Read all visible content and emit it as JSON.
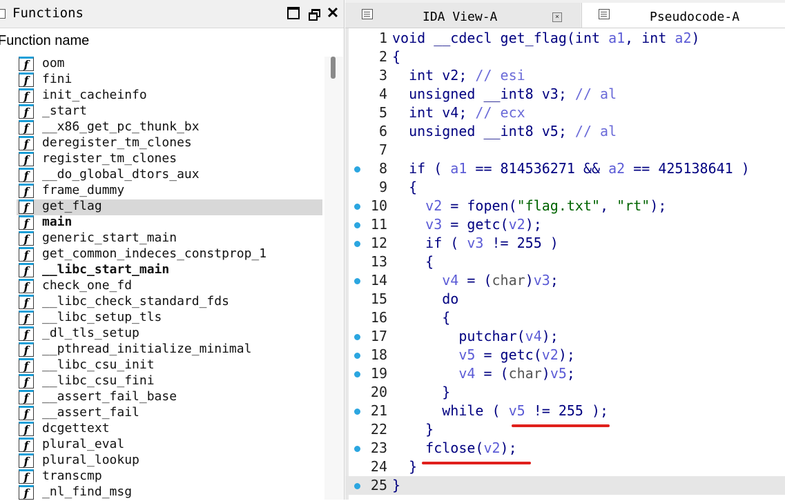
{
  "functions_panel": {
    "title": "Functions",
    "column_header": "Function name",
    "icon_glyph": "f",
    "items": [
      {
        "name": "oom",
        "bold": false,
        "selected": false
      },
      {
        "name": "fini",
        "bold": false,
        "selected": false
      },
      {
        "name": "init_cacheinfo",
        "bold": false,
        "selected": false
      },
      {
        "name": "_start",
        "bold": false,
        "selected": false
      },
      {
        "name": "__x86_get_pc_thunk_bx",
        "bold": false,
        "selected": false
      },
      {
        "name": "deregister_tm_clones",
        "bold": false,
        "selected": false
      },
      {
        "name": "register_tm_clones",
        "bold": false,
        "selected": false
      },
      {
        "name": "__do_global_dtors_aux",
        "bold": false,
        "selected": false
      },
      {
        "name": "frame_dummy",
        "bold": false,
        "selected": false
      },
      {
        "name": "get_flag",
        "bold": false,
        "selected": true
      },
      {
        "name": "main",
        "bold": true,
        "selected": false
      },
      {
        "name": "generic_start_main",
        "bold": false,
        "selected": false
      },
      {
        "name": "get_common_indeces_constprop_1",
        "bold": false,
        "selected": false
      },
      {
        "name": "__libc_start_main",
        "bold": true,
        "selected": false
      },
      {
        "name": "check_one_fd",
        "bold": false,
        "selected": false
      },
      {
        "name": "__libc_check_standard_fds",
        "bold": false,
        "selected": false
      },
      {
        "name": "__libc_setup_tls",
        "bold": false,
        "selected": false
      },
      {
        "name": "_dl_tls_setup",
        "bold": false,
        "selected": false
      },
      {
        "name": "__pthread_initialize_minimal",
        "bold": false,
        "selected": false
      },
      {
        "name": "__libc_csu_init",
        "bold": false,
        "selected": false
      },
      {
        "name": "__libc_csu_fini",
        "bold": false,
        "selected": false
      },
      {
        "name": "__assert_fail_base",
        "bold": false,
        "selected": false
      },
      {
        "name": "__assert_fail",
        "bold": false,
        "selected": false
      },
      {
        "name": "dcgettext",
        "bold": false,
        "selected": false
      },
      {
        "name": "plural_eval",
        "bold": false,
        "selected": false
      },
      {
        "name": "plural_lookup",
        "bold": false,
        "selected": false
      },
      {
        "name": "transcmp",
        "bold": false,
        "selected": false
      },
      {
        "name": "_nl_find_msg",
        "bold": false,
        "selected": false
      }
    ]
  },
  "tabs": [
    {
      "label": "IDA View-A",
      "icon": "listing-icon",
      "active": false,
      "has_close": true,
      "close_glyph": "×"
    },
    {
      "label": "Pseudocode-A",
      "icon": "listing-icon",
      "active": true,
      "has_close": false
    }
  ],
  "colors": {
    "keyword": "#000080",
    "variable": "#5b5bd6",
    "comment": "#6a6ad8",
    "string": "#006400",
    "breakpoint_dot": "#2ba6e0",
    "annotation_underline": "#e0201c"
  },
  "pseudocode": {
    "current_line": 25,
    "lines": [
      {
        "n": "1",
        "bp": false,
        "tokens": [
          [
            "kw",
            "void __cdecl get_flag(int "
          ],
          [
            "var",
            "a1"
          ],
          [
            "kw",
            ", int "
          ],
          [
            "var",
            "a2"
          ],
          [
            "kw",
            ")"
          ]
        ]
      },
      {
        "n": "2",
        "bp": false,
        "tokens": [
          [
            "kw",
            "{"
          ]
        ]
      },
      {
        "n": "3",
        "bp": false,
        "tokens": [
          [
            "kw",
            "  int v2; "
          ],
          [
            "com",
            "// esi"
          ]
        ]
      },
      {
        "n": "4",
        "bp": false,
        "tokens": [
          [
            "kw",
            "  unsigned __int8 v3; "
          ],
          [
            "com",
            "// al"
          ]
        ]
      },
      {
        "n": "5",
        "bp": false,
        "tokens": [
          [
            "kw",
            "  int v4; "
          ],
          [
            "com",
            "// ecx"
          ]
        ]
      },
      {
        "n": "6",
        "bp": false,
        "tokens": [
          [
            "kw",
            "  unsigned __int8 v5; "
          ],
          [
            "com",
            "// al"
          ]
        ]
      },
      {
        "n": "7",
        "bp": false,
        "tokens": []
      },
      {
        "n": "8",
        "bp": true,
        "tokens": [
          [
            "kw",
            "  if ( "
          ],
          [
            "var",
            "a1"
          ],
          [
            "kw",
            " == 814536271 && "
          ],
          [
            "var",
            "a2"
          ],
          [
            "kw",
            " == 425138641 )"
          ]
        ]
      },
      {
        "n": "9",
        "bp": false,
        "tokens": [
          [
            "kw",
            "  {"
          ]
        ]
      },
      {
        "n": "10",
        "bp": true,
        "tokens": [
          [
            "kw",
            "    "
          ],
          [
            "var",
            "v2"
          ],
          [
            "kw",
            " = fopen("
          ],
          [
            "str",
            "\"flag.txt\""
          ],
          [
            "kw",
            ", "
          ],
          [
            "str",
            "\"rt\""
          ],
          [
            "kw",
            ");"
          ]
        ]
      },
      {
        "n": "11",
        "bp": true,
        "tokens": [
          [
            "kw",
            "    "
          ],
          [
            "var",
            "v3"
          ],
          [
            "kw",
            " = getc("
          ],
          [
            "var",
            "v2"
          ],
          [
            "kw",
            ");"
          ]
        ]
      },
      {
        "n": "12",
        "bp": true,
        "tokens": [
          [
            "kw",
            "    if ( "
          ],
          [
            "var",
            "v3"
          ],
          [
            "kw",
            " != 255 )"
          ]
        ]
      },
      {
        "n": "13",
        "bp": false,
        "tokens": [
          [
            "kw",
            "    {"
          ]
        ]
      },
      {
        "n": "14",
        "bp": true,
        "tokens": [
          [
            "kw",
            "      "
          ],
          [
            "var",
            "v4"
          ],
          [
            "kw",
            " = ("
          ],
          [
            "cast",
            "char"
          ],
          [
            "kw",
            ")"
          ],
          [
            "var",
            "v3"
          ],
          [
            "kw",
            ";"
          ]
        ]
      },
      {
        "n": "15",
        "bp": false,
        "tokens": [
          [
            "kw",
            "      do"
          ]
        ]
      },
      {
        "n": "16",
        "bp": false,
        "tokens": [
          [
            "kw",
            "      {"
          ]
        ]
      },
      {
        "n": "17",
        "bp": true,
        "tokens": [
          [
            "kw",
            "        putchar("
          ],
          [
            "var",
            "v4"
          ],
          [
            "kw",
            ");"
          ]
        ]
      },
      {
        "n": "18",
        "bp": true,
        "tokens": [
          [
            "kw",
            "        "
          ],
          [
            "var",
            "v5"
          ],
          [
            "kw",
            " = getc("
          ],
          [
            "var",
            "v2"
          ],
          [
            "kw",
            ");"
          ]
        ]
      },
      {
        "n": "19",
        "bp": true,
        "tokens": [
          [
            "kw",
            "        "
          ],
          [
            "var",
            "v4"
          ],
          [
            "kw",
            " = ("
          ],
          [
            "cast",
            "char"
          ],
          [
            "kw",
            ")"
          ],
          [
            "var",
            "v5"
          ],
          [
            "kw",
            ";"
          ]
        ]
      },
      {
        "n": "20",
        "bp": false,
        "tokens": [
          [
            "kw",
            "      }"
          ]
        ]
      },
      {
        "n": "21",
        "bp": true,
        "tokens": [
          [
            "kw",
            "      while ( "
          ],
          [
            "var",
            "v5"
          ],
          [
            "kw",
            " != 255 );"
          ]
        ]
      },
      {
        "n": "22",
        "bp": false,
        "tokens": [
          [
            "kw",
            "    }"
          ]
        ]
      },
      {
        "n": "23",
        "bp": true,
        "tokens": [
          [
            "kw",
            "    fclose("
          ],
          [
            "var",
            "v2"
          ],
          [
            "kw",
            ");"
          ]
        ]
      },
      {
        "n": "24",
        "bp": false,
        "tokens": [
          [
            "kw",
            "  }"
          ]
        ]
      },
      {
        "n": "25",
        "bp": true,
        "tokens": [
          [
            "kw",
            "}"
          ]
        ]
      }
    ]
  }
}
